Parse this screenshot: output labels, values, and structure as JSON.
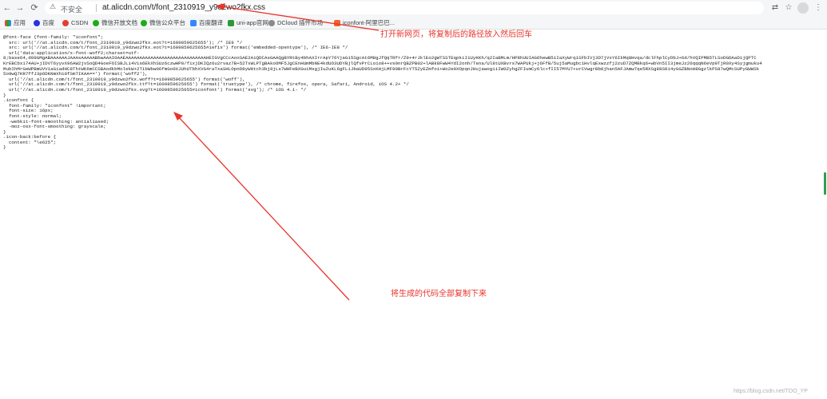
{
  "toolbar": {
    "insecure_label": "不安全",
    "url": "at.alicdn.com/t/font_2310919_y9dzwo2fkx.css"
  },
  "bookmarks": [
    {
      "label": "应用",
      "icon": "apps-grid-icon",
      "color": "#e8453c"
    },
    {
      "label": "百度",
      "icon": "baidu-icon",
      "color": "#2932e1"
    },
    {
      "label": "CSDN",
      "icon": "csdn-icon",
      "color": "#e33e33"
    },
    {
      "label": "微信开放文档",
      "icon": "wechat-icon",
      "color": "#1aad19"
    },
    {
      "label": "微信公众平台",
      "icon": "wechat-icon",
      "color": "#1aad19"
    },
    {
      "label": "百度翻译",
      "icon": "baidu-translate-icon",
      "color": "#3388ff"
    },
    {
      "label": "uni-app官网",
      "icon": "uniapp-icon",
      "color": "#2b9939"
    },
    {
      "label": "DCloud 插件市场",
      "icon": "dcloud-icon",
      "color": "#8a8a8a"
    },
    {
      "label": "iconfont-阿里巴巴...",
      "icon": "iconfont-icon",
      "color": "#f1662a"
    }
  ],
  "code_lines": [
    "@font-face {font-family: \"iconfont\";",
    "  src: url('//at.alicdn.com/t/font_2310919_y9dzwo2fkx.eot?t=1609859625655'); /* IE9 */",
    "  src: url('//at.alicdn.com/t/font_2310919_y9dzwo2fkx.eot?t=1609859625655#iefix') format('embedded-opentype'), /* IE6-IE8 */",
    "  url('data:application/x-font-woff2;charset=utf-",
    "8;base64,d09GMgABAAAAAAJAAAsAAAAABbwAAAI0AAEAAAAAAAAAAAAAAAAAAAAAAAAAAAAAHEIGVgCCcAooSAE2AiQDCAsGAAQgBYRtBy4bhAXIrrApY76YjaGi5SgcAt6M8gJfQqTRfr/Z9+4rJklEo2gWTSSTEqpkiI1UyKKh/q2IaBMLm/HP8hUUIAG6hewB5iIaXyWrq1SFbIVj3D7jVxY6IkMq8Hvqa/dclFhplCyDbJ+6d/hVQIPMB5TLSoDGDAaDijQPTC",
    "KrEBCbxi74AU+jIDVT6yyvX96AW2jvSoQD4GoeFOISBJL14Vis6EkXhSUz6czwHP0/fixjDKIQz6u2rvaz7B+52TxWLPTgBAkoOMF5JgCEnHUmMbNE4kdUO3UDYBjlQfvPrCLo1o8++vs0nrQBZPB02+lABk8FwW4YdI2onh/Tena/Ul8tUXBvrs7WAPUkj+j6FfB/5uj5aMugbc1HvlqExwzzfj2zuD7ZQMBkq6+wbVn5II3jmeJz26qqqN6eVp9TjR0Xy4Syjgmuku4",
    "MubIhMrGeWPBmUVV1aGiadHC8ThtWK6mCCSBAodkbMolekW+2TibWbw06fmGo0XJUhUTbhXVG4raTxaSHLOpnD8yW0tch3bj8jLs7WHFeBXGuiMsgjIuZuKL6gFLiJbaUD95SxKHjLMF90BrFcYT5ZyEZmfoi+Wo2e0XOpqnJHujawogiiIW0ZyhgZFIumCy6lc+fII57MYU7+urCVwgrBb0jhan5AFJAmw7qe5RXSg88S014yGGZBNoH8GgzlkPS87wQMcSUPyGWWSk",
    "5o9wQ7KR7ffJ3p6DKNmXh10fSmTIKAA==') format('woff2'),",
    "  url('//at.alicdn.com/t/font_2310919_y9dzwo2fkx.woff?t=1609859625655') format('woff'),",
    "  url('//at.alicdn.com/t/font_2310919_y9dzwo2fkx.ttf?t=1609859625655') format('truetype'), /* chrome, firefox, opera, Safari, Android, iOS 4.2+ */",
    "  url('//at.alicdn.com/t/font_2310919_y9dzwo2fkx.svg?t=1609859625655#iconfont') format('svg'); /* iOS 4.1- */",
    "}",
    "",
    ".iconfont {",
    "  font-family: \"iconfont\" !important;",
    "  font-size: 16px;",
    "  font-style: normal;",
    "  -webkit-font-smoothing: antialiased;",
    "  -moz-osx-font-smoothing: grayscale;",
    "}",
    "",
    ".icon-back:before {",
    "  content: \"\\e625\";",
    "}"
  ],
  "annotations": {
    "top": "打开新网页，将复制后的路径放入然后回车",
    "middle": "将生成的代码全部复制下来"
  },
  "watermark": "https://blog.csdn.net/TOO_YP",
  "colors": {
    "annotation": "#e8342c",
    "accent": "#2e9e53"
  }
}
